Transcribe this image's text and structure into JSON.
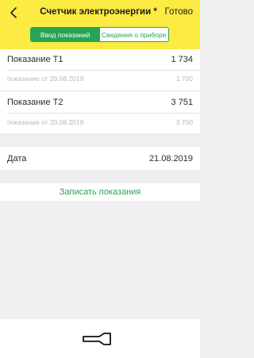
{
  "header": {
    "title": "Счетчик электроэнергии *",
    "done_label": "Готово",
    "back_icon": "chevron-left-icon"
  },
  "tabs": [
    {
      "label": "Ввод показаний",
      "active": true
    },
    {
      "label": "Сведения о приборе",
      "active": false
    }
  ],
  "readings": [
    {
      "label": "Показание Т1",
      "value": "1 734",
      "prev_label": "показание от 20.08.2019",
      "prev_value": "1 700"
    },
    {
      "label": "Показание Т2",
      "value": "3 751",
      "prev_label": "показание от 20.08.2019",
      "prev_value": "3 700"
    }
  ],
  "date": {
    "label": "Дата",
    "value": "21.08.2019"
  },
  "action": {
    "label": "Записать показания"
  },
  "toolbar": {
    "flashlight_icon": "flashlight-icon"
  },
  "colors": {
    "header_bg": "#fbeb43",
    "accent": "#27a455",
    "background": "#efefef"
  }
}
